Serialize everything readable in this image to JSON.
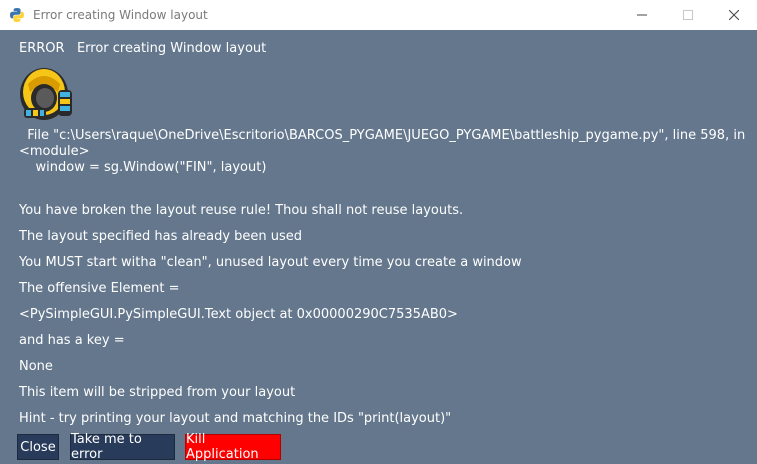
{
  "window": {
    "title": "Error creating Window layout",
    "controls": [
      "minimize-icon",
      "maximize-icon",
      "close-icon"
    ]
  },
  "header": {
    "prefix": "ERROR",
    "message": "Error creating Window layout"
  },
  "traceback": {
    "line1": "  File \"c:\\Users\\raque\\OneDrive\\Escritorio\\BARCOS_PYGAME\\JUEGO_PYGAME\\battleship_pygame.py\", line 598, in",
    "line2": "<module>",
    "line3": "    window = sg.Window(\"FIN\", layout)"
  },
  "messages": [
    "You have broken the layout reuse rule! Thou shall not reuse layouts.",
    "The layout specified has already been used",
    "You MUST start witha \"clean\", unused layout every time you create a window",
    "The offensive Element =",
    "<PySimpleGUI.PySimpleGUI.Text object at 0x00000290C7535AB0>",
    "and has a key =",
    "None",
    "This item will be stripped from your layout",
    "Hint - try printing your layout and matching the IDs \"print(layout)\""
  ],
  "buttons": {
    "close": "Close",
    "take_me": "Take me to error",
    "kill": "Kill Application"
  },
  "colors": {
    "background": "#64778d",
    "button": "#283b5b",
    "kill_button": "#ff0000",
    "text": "#ffffff"
  }
}
